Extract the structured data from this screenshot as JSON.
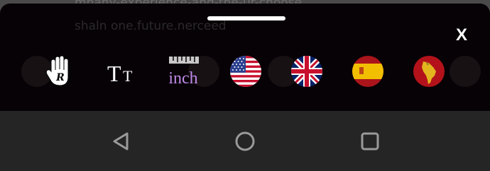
{
  "background": {
    "text_line_1": "mpany-experience-and-the-ur-choose",
    "text_line_2": "shaln one.future.nerceed"
  },
  "sheet": {
    "close_label": "X",
    "tools": [
      {
        "name": "hand-r-icon",
        "glyph": "R"
      },
      {
        "name": "text-size-icon",
        "glyph": "TT"
      },
      {
        "name": "inch-units-icon",
        "label": "inch"
      }
    ],
    "flags": [
      {
        "name": "us-flag-icon",
        "language": "English (US)"
      },
      {
        "name": "uk-flag-icon",
        "language": "English (UK)"
      },
      {
        "name": "spain-flag-icon",
        "language": "Spanish (Spain)"
      },
      {
        "name": "latin-america-flag-icon",
        "language": "Spanish (Latin America)"
      }
    ]
  },
  "navbar": {
    "back": "back-triangle-icon",
    "home": "home-circle-icon",
    "recents": "recents-square-icon"
  },
  "colors": {
    "sheet_bg": "#070206",
    "navbar_bg": "#252525",
    "inch_purple": "#c08ae8",
    "nav_icon": "#9a9a9a"
  }
}
